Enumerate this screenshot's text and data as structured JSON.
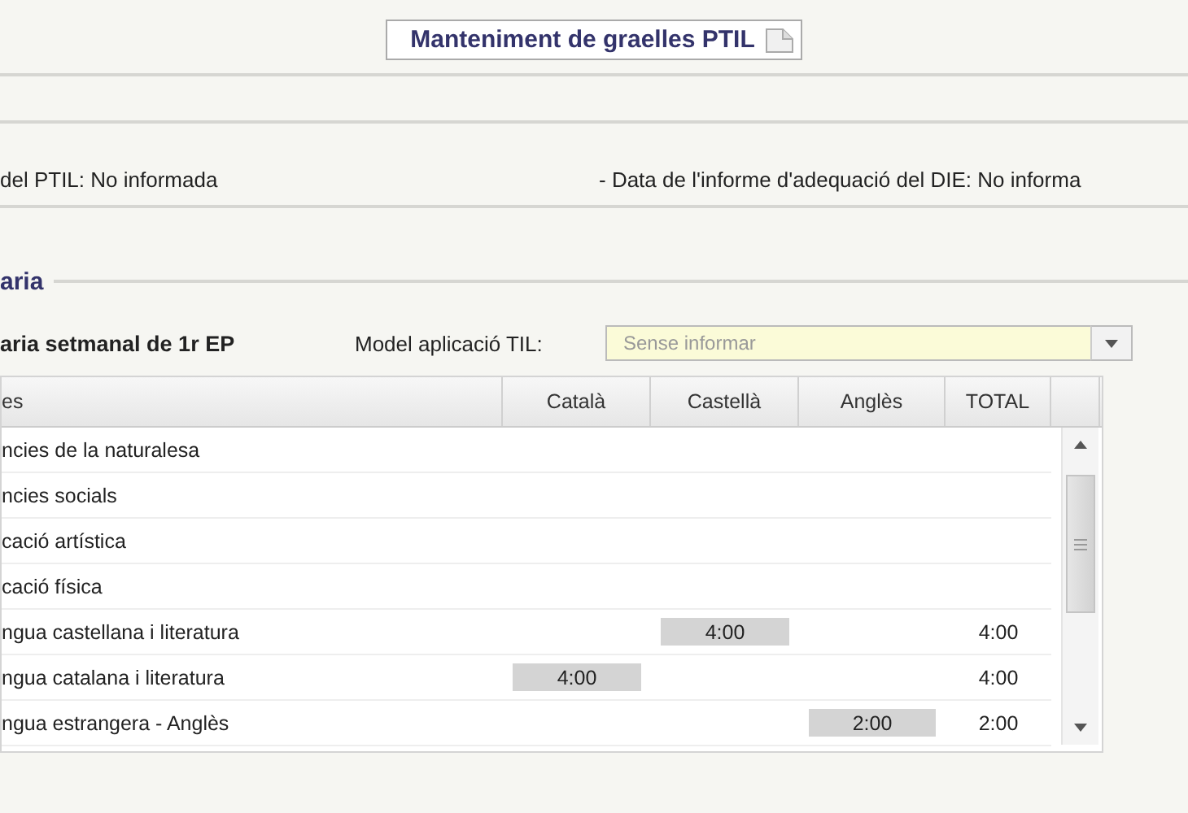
{
  "title": "Manteniment de graelles PTIL",
  "info": {
    "left": "del PTIL: No informada",
    "right": "- Data de l'informe d'adequació del DIE: No informa"
  },
  "section": {
    "legend": "aria"
  },
  "grid_title": "aria setmanal de 1r EP",
  "model": {
    "label": "Model aplicació TIL:",
    "placeholder": "Sense informar"
  },
  "table": {
    "columns": [
      "es",
      "Català",
      "Castellà",
      "Anglès",
      "TOTAL"
    ],
    "rows": [
      {
        "name": "ncies de la naturalesa"
      },
      {
        "name": "ncies socials"
      },
      {
        "name": "cació artística"
      },
      {
        "name": "cació física"
      },
      {
        "name": "ngua castellana i literatura",
        "castella": "4:00",
        "total": "4:00"
      },
      {
        "name": "ngua catalana i literatura",
        "catala": "4:00",
        "total": "4:00"
      },
      {
        "name": "ngua estrangera - Anglès",
        "angles": "2:00",
        "total": "2:00"
      }
    ]
  }
}
